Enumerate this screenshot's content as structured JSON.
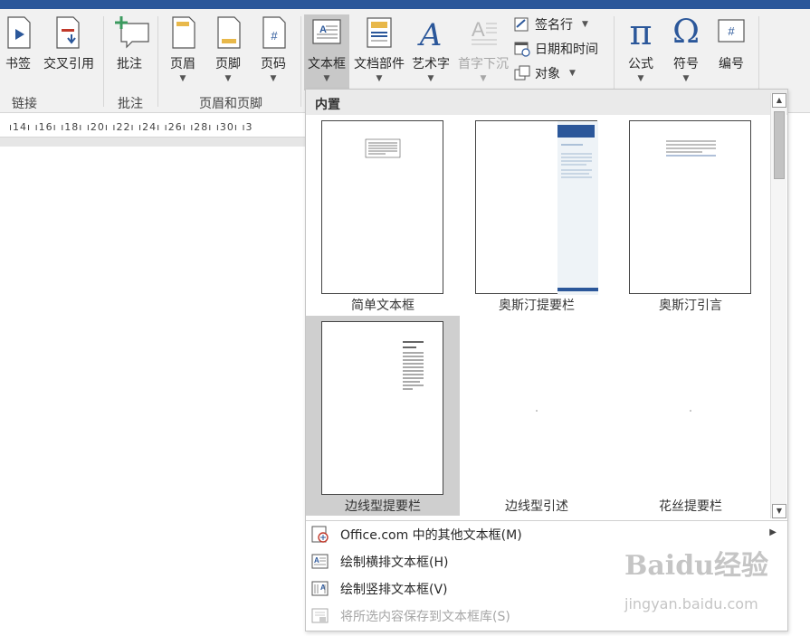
{
  "ribbon": {
    "buttons": {
      "bookmark": "书签",
      "cross_reference": "交叉引用",
      "comment": "批注",
      "header": "页眉",
      "footer": "页脚",
      "page_number": "页码",
      "text_box": "文本框",
      "quick_parts": "文档部件",
      "wordart": "艺术字",
      "drop_cap": "首字下沉",
      "equation": "公式",
      "symbol": "符号",
      "number": "编号"
    },
    "small_buttons": {
      "signature_line": "签名行",
      "date_time": "日期和时间",
      "object": "对象"
    },
    "groups": {
      "links": "链接",
      "comments": "批注",
      "header_footer": "页眉和页脚"
    },
    "icon_glyphs": {
      "pi": "π",
      "omega": "Ω",
      "hash": "#",
      "wordart_a": "A"
    }
  },
  "ruler": {
    "ticks": "ı14ı  ı16ı  ı18ı  ı20ı  ı22ı  ı24ı  ı26ı  ı28ı  ı30ı  ı3"
  },
  "dropdown": {
    "section_title": "内置",
    "gallery": [
      {
        "label": "简单文本框"
      },
      {
        "label": "奥斯汀提要栏"
      },
      {
        "label": "奥斯汀引言"
      },
      {
        "label": "边线型提要栏",
        "selected": true
      },
      {
        "label": "边线型引述"
      },
      {
        "label": "花丝提要栏"
      }
    ],
    "menu": [
      {
        "label": "Office.com 中的其他文本框(M)",
        "has_submenu": true,
        "enabled": true
      },
      {
        "label": "绘制横排文本框(H)",
        "enabled": true
      },
      {
        "label": "绘制竖排文本框(V)",
        "enabled": true
      },
      {
        "label": "将所选内容保存到文本框库(S)",
        "enabled": false
      }
    ]
  },
  "watermark": {
    "logo_text": "Baidu经验",
    "url": "jingyan.baidu.com"
  },
  "colors": {
    "accent": "#2b579a",
    "selected": "#c8c8c8",
    "icon_blue": "#2b579a"
  }
}
